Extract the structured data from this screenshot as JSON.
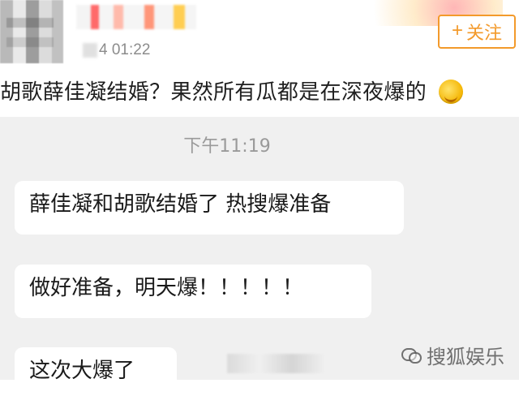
{
  "post": {
    "time": "4 01:22",
    "follow_label": "关注",
    "follow_plus": "+",
    "text": "胡歌薛佳凝结婚？果然所有瓜都是在深夜爆的"
  },
  "chat": {
    "timestamp": "下午11:19",
    "messages": [
      {
        "text": "薛佳凝和胡歌结婚了 热搜爆准备"
      },
      {
        "text": "做好准备，明天爆！！！！！"
      },
      {
        "text": "这次大爆了"
      }
    ]
  },
  "watermark": {
    "text": "搜狐娱乐"
  },
  "icons": {
    "emoji": "blushing-smiley-icon",
    "watermark": "chat-bubbles-icon"
  }
}
